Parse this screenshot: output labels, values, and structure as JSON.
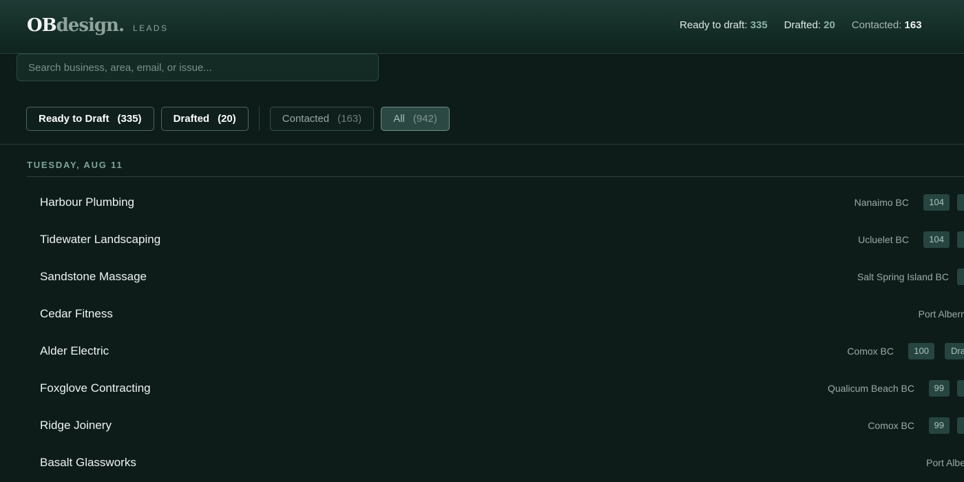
{
  "header": {
    "logo_ob": "OB",
    "logo_design": "design.",
    "logo_section": "LEADS",
    "stats": [
      {
        "label": "Ready to draft:",
        "value": "335"
      },
      {
        "label": "Drafted:",
        "value": "20"
      },
      {
        "label": "Contacted:",
        "value": "163"
      }
    ]
  },
  "search": {
    "placeholder": "Search business, area, email, or issue...",
    "value": ""
  },
  "filters": [
    {
      "label": "Ready to Draft",
      "count": "(335)"
    },
    {
      "label": "Drafted",
      "count": "(20)"
    },
    {
      "label": "Contacted",
      "count": "(163)"
    },
    {
      "label": "All",
      "count": "(942)"
    }
  ],
  "active_filter": "All",
  "group": {
    "title": "TUESDAY, AUG 11",
    "leads": [
      {
        "name": "Harbour Plumbing",
        "location": "Nanaimo BC",
        "score": "104",
        "tag": ""
      },
      {
        "name": "Tidewater Landscaping",
        "location": "Ucluelet BC",
        "score": "104",
        "tag": ""
      },
      {
        "name": "Sandstone Massage",
        "location": "Salt Spring Island BC",
        "score": "",
        "tag": ""
      },
      {
        "name": "Cedar Fitness",
        "location": "Port Alberni",
        "score": "",
        "tag": ""
      },
      {
        "name": "Alder Electric",
        "location": "Comox BC",
        "score": "100",
        "tag": "Dra"
      },
      {
        "name": "Foxglove Contracting",
        "location": "Qualicum Beach BC",
        "score": "99",
        "tag": ""
      },
      {
        "name": "Ridge Joinery",
        "location": "Comox BC",
        "score": "99",
        "tag": ""
      },
      {
        "name": "Basalt Glassworks",
        "location": "Port Albe",
        "score": "",
        "tag": ""
      }
    ]
  }
}
